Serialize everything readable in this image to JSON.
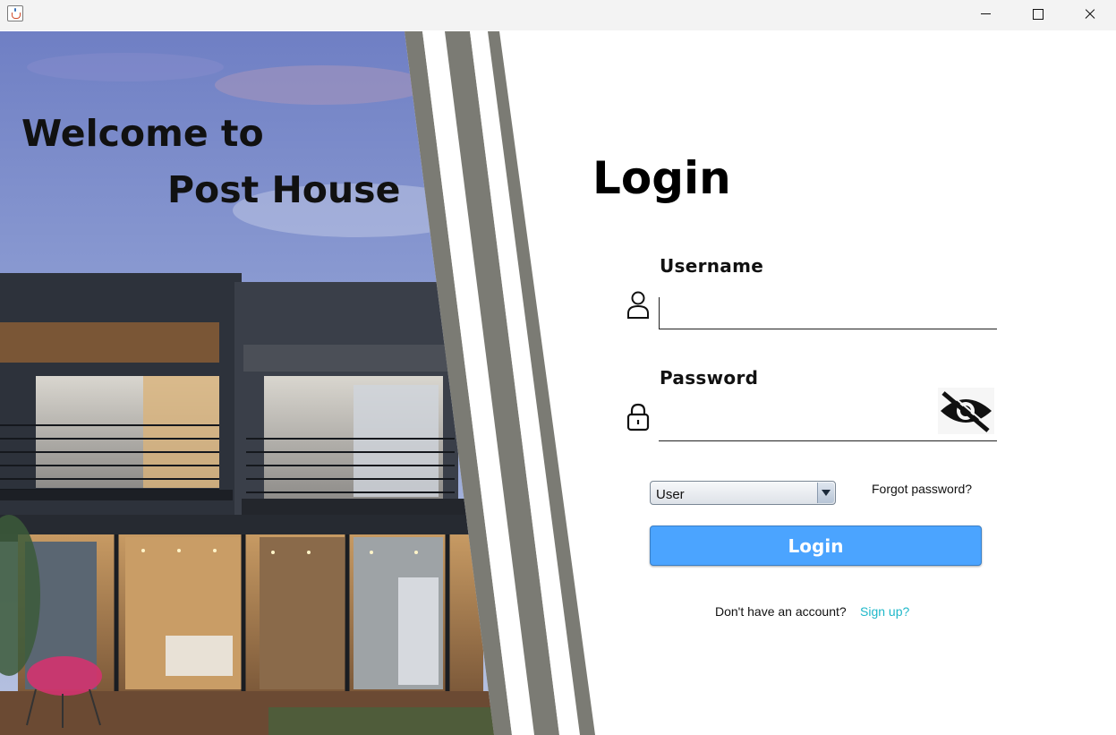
{
  "window": {
    "app_icon": "java-cup-icon",
    "controls": [
      "minimize-icon",
      "maximize-icon",
      "close-icon"
    ]
  },
  "hero": {
    "welcome_line1": "Welcome to",
    "welcome_line2": "Post House",
    "image": "modern-two-story-house-photo"
  },
  "form": {
    "title": "Login",
    "username_label": "Username",
    "username_value": "",
    "password_label": "Password",
    "password_value": "",
    "role_selected": "User",
    "forgot_password": "Forgot password?",
    "login_button": "Login",
    "no_account_text": "Don't have an account?",
    "signup_link": "Sign up?",
    "icons": {
      "username": "user-icon",
      "password": "lock-icon",
      "visibility": "eye-slash-icon"
    }
  },
  "colors": {
    "login_button": "#4ba4ff",
    "signup_link": "#1fb8c9",
    "stripe_gray": "#7b7b74"
  }
}
